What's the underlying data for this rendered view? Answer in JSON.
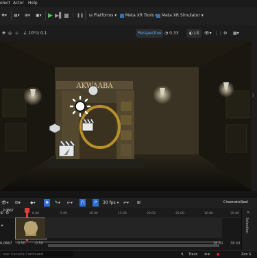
{
  "menu": [
    "elect",
    "Actor",
    "Help"
  ],
  "toolbar": {
    "snap_value": "10",
    "snap_value2": "0.1",
    "platforms_label": "Platforms",
    "xr_tools_label": "Meta XR Tools",
    "xr_sim_label": "Meta XR Simulator"
  },
  "viewport_toolbar": {
    "angle": "10°",
    "snap": "0.1",
    "view_mode": "Perspective",
    "scale": "0.33",
    "lit": "Lit"
  },
  "scene": {
    "sign_text": "AKWAABA"
  },
  "sequencer": {
    "fps": "30 fps",
    "sequence_name": "CinematicReel",
    "current_frame": "2.0667",
    "frame_start": "0.0667",
    "in_point": "-0.50",
    "out_point": "-0.50",
    "end_a": "38.50",
    "end_b": "38.50",
    "ticks": [
      "0.00",
      "5.00",
      "10.00",
      "15.00",
      "20.00",
      "25.00",
      "30.00",
      "35.00"
    ],
    "side_label": "Selection"
  },
  "status": {
    "console_placeholder": "nter Console Command",
    "trace": "Trace",
    "zen": "Zen S"
  }
}
